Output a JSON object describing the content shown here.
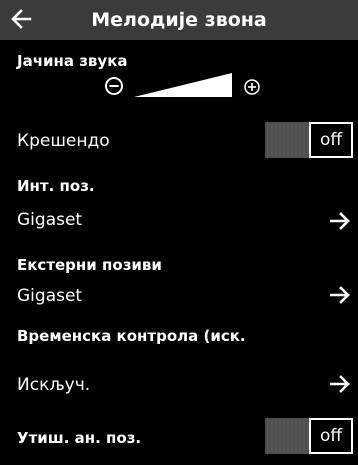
{
  "header": {
    "title": "Мелодије звона",
    "back_icon": "back-arrow-icon"
  },
  "volume": {
    "label": "Јачина звука",
    "level": 0.75,
    "minus_icon": "minus-circle-icon",
    "plus_icon": "plus-circle-icon"
  },
  "crescendo": {
    "label": "Крешендо",
    "state": "off"
  },
  "internal_calls": {
    "section": "Инт. поз.",
    "value": "Gigaset"
  },
  "external_calls": {
    "section": "Екстерни позиви",
    "value": "Gigaset"
  },
  "time_control": {
    "section": "Временска контрола (иск.",
    "value": "Искључ."
  },
  "mute_anonymous": {
    "label": "Утиш. ан. поз.",
    "state": "off"
  }
}
